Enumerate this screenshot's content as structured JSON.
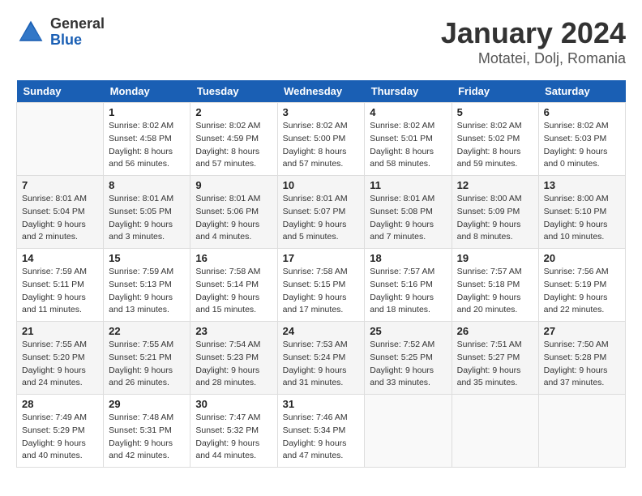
{
  "logo": {
    "general": "General",
    "blue": "Blue"
  },
  "header": {
    "month": "January 2024",
    "location": "Motatei, Dolj, Romania"
  },
  "weekdays": [
    "Sunday",
    "Monday",
    "Tuesday",
    "Wednesday",
    "Thursday",
    "Friday",
    "Saturday"
  ],
  "weeks": [
    [
      {
        "day": "",
        "info": ""
      },
      {
        "day": "1",
        "info": "Sunrise: 8:02 AM\nSunset: 4:58 PM\nDaylight: 8 hours\nand 56 minutes."
      },
      {
        "day": "2",
        "info": "Sunrise: 8:02 AM\nSunset: 4:59 PM\nDaylight: 8 hours\nand 57 minutes."
      },
      {
        "day": "3",
        "info": "Sunrise: 8:02 AM\nSunset: 5:00 PM\nDaylight: 8 hours\nand 57 minutes."
      },
      {
        "day": "4",
        "info": "Sunrise: 8:02 AM\nSunset: 5:01 PM\nDaylight: 8 hours\nand 58 minutes."
      },
      {
        "day": "5",
        "info": "Sunrise: 8:02 AM\nSunset: 5:02 PM\nDaylight: 8 hours\nand 59 minutes."
      },
      {
        "day": "6",
        "info": "Sunrise: 8:02 AM\nSunset: 5:03 PM\nDaylight: 9 hours\nand 0 minutes."
      }
    ],
    [
      {
        "day": "7",
        "info": "Sunrise: 8:01 AM\nSunset: 5:04 PM\nDaylight: 9 hours\nand 2 minutes."
      },
      {
        "day": "8",
        "info": "Sunrise: 8:01 AM\nSunset: 5:05 PM\nDaylight: 9 hours\nand 3 minutes."
      },
      {
        "day": "9",
        "info": "Sunrise: 8:01 AM\nSunset: 5:06 PM\nDaylight: 9 hours\nand 4 minutes."
      },
      {
        "day": "10",
        "info": "Sunrise: 8:01 AM\nSunset: 5:07 PM\nDaylight: 9 hours\nand 5 minutes."
      },
      {
        "day": "11",
        "info": "Sunrise: 8:01 AM\nSunset: 5:08 PM\nDaylight: 9 hours\nand 7 minutes."
      },
      {
        "day": "12",
        "info": "Sunrise: 8:00 AM\nSunset: 5:09 PM\nDaylight: 9 hours\nand 8 minutes."
      },
      {
        "day": "13",
        "info": "Sunrise: 8:00 AM\nSunset: 5:10 PM\nDaylight: 9 hours\nand 10 minutes."
      }
    ],
    [
      {
        "day": "14",
        "info": "Sunrise: 7:59 AM\nSunset: 5:11 PM\nDaylight: 9 hours\nand 11 minutes."
      },
      {
        "day": "15",
        "info": "Sunrise: 7:59 AM\nSunset: 5:13 PM\nDaylight: 9 hours\nand 13 minutes."
      },
      {
        "day": "16",
        "info": "Sunrise: 7:58 AM\nSunset: 5:14 PM\nDaylight: 9 hours\nand 15 minutes."
      },
      {
        "day": "17",
        "info": "Sunrise: 7:58 AM\nSunset: 5:15 PM\nDaylight: 9 hours\nand 17 minutes."
      },
      {
        "day": "18",
        "info": "Sunrise: 7:57 AM\nSunset: 5:16 PM\nDaylight: 9 hours\nand 18 minutes."
      },
      {
        "day": "19",
        "info": "Sunrise: 7:57 AM\nSunset: 5:18 PM\nDaylight: 9 hours\nand 20 minutes."
      },
      {
        "day": "20",
        "info": "Sunrise: 7:56 AM\nSunset: 5:19 PM\nDaylight: 9 hours\nand 22 minutes."
      }
    ],
    [
      {
        "day": "21",
        "info": "Sunrise: 7:55 AM\nSunset: 5:20 PM\nDaylight: 9 hours\nand 24 minutes."
      },
      {
        "day": "22",
        "info": "Sunrise: 7:55 AM\nSunset: 5:21 PM\nDaylight: 9 hours\nand 26 minutes."
      },
      {
        "day": "23",
        "info": "Sunrise: 7:54 AM\nSunset: 5:23 PM\nDaylight: 9 hours\nand 28 minutes."
      },
      {
        "day": "24",
        "info": "Sunrise: 7:53 AM\nSunset: 5:24 PM\nDaylight: 9 hours\nand 31 minutes."
      },
      {
        "day": "25",
        "info": "Sunrise: 7:52 AM\nSunset: 5:25 PM\nDaylight: 9 hours\nand 33 minutes."
      },
      {
        "day": "26",
        "info": "Sunrise: 7:51 AM\nSunset: 5:27 PM\nDaylight: 9 hours\nand 35 minutes."
      },
      {
        "day": "27",
        "info": "Sunrise: 7:50 AM\nSunset: 5:28 PM\nDaylight: 9 hours\nand 37 minutes."
      }
    ],
    [
      {
        "day": "28",
        "info": "Sunrise: 7:49 AM\nSunset: 5:29 PM\nDaylight: 9 hours\nand 40 minutes."
      },
      {
        "day": "29",
        "info": "Sunrise: 7:48 AM\nSunset: 5:31 PM\nDaylight: 9 hours\nand 42 minutes."
      },
      {
        "day": "30",
        "info": "Sunrise: 7:47 AM\nSunset: 5:32 PM\nDaylight: 9 hours\nand 44 minutes."
      },
      {
        "day": "31",
        "info": "Sunrise: 7:46 AM\nSunset: 5:34 PM\nDaylight: 9 hours\nand 47 minutes."
      },
      {
        "day": "",
        "info": ""
      },
      {
        "day": "",
        "info": ""
      },
      {
        "day": "",
        "info": ""
      }
    ]
  ]
}
